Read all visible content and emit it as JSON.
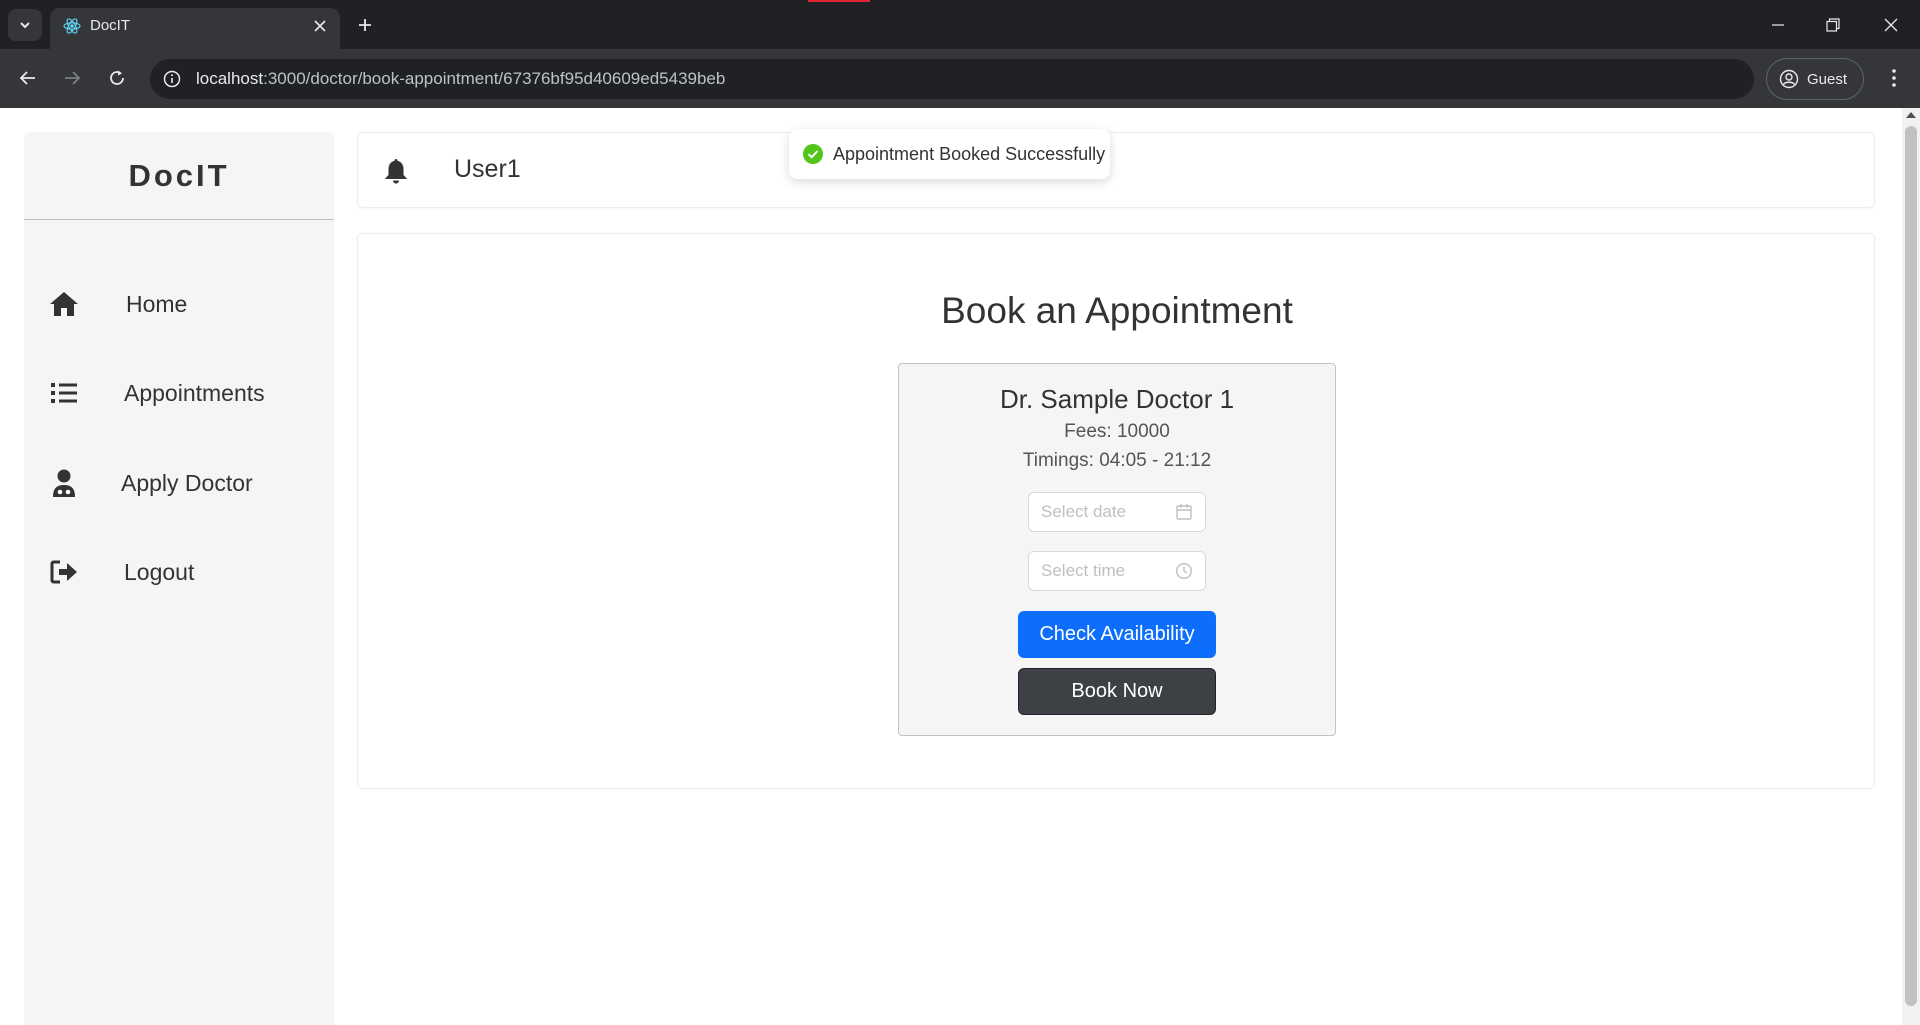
{
  "browser": {
    "tab_title": "DocIT",
    "url_host": "localhost",
    "url_rest": ":3000/doctor/book-appointment/67376bf95d40609ed5439beb",
    "profile_label": "Guest"
  },
  "sidebar": {
    "brand": "DocIT",
    "items": [
      {
        "label": "Home",
        "icon": "home-icon"
      },
      {
        "label": "Appointments",
        "icon": "list-icon"
      },
      {
        "label": "Apply Doctor",
        "icon": "doctor-icon"
      },
      {
        "label": "Logout",
        "icon": "logout-icon"
      }
    ]
  },
  "header": {
    "username": "User1",
    "icon": "bell-icon"
  },
  "toast": {
    "message": "Appointment Booked Successfully",
    "color": "#52c41a"
  },
  "booking": {
    "title": "Book an Appointment",
    "doctor_name": "Dr. Sample Doctor 1",
    "fees": "Fees: 10000",
    "timings": "Timings: 04:05 - 21:12",
    "date_placeholder": "Select date",
    "time_placeholder": "Select time",
    "check_button": "Check Availability",
    "book_button": "Book Now"
  },
  "colors": {
    "primary": "#0d6efd",
    "dark_button": "#3d4044",
    "sidebar_bg": "#f5f5f5"
  }
}
